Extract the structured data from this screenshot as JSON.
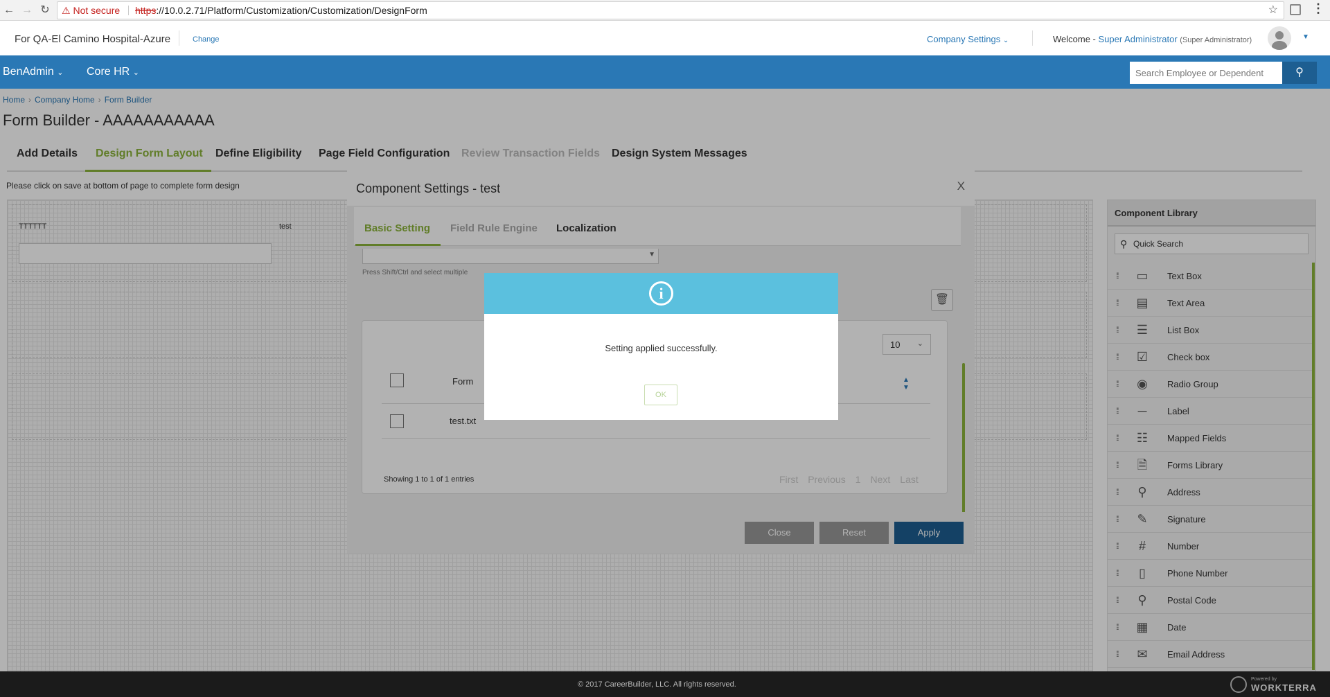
{
  "browser": {
    "security": "Not secure",
    "url_proto": "https",
    "url_rest": "://10.0.2.71/Platform/Customization/Customization/DesignForm"
  },
  "header": {
    "company": "For QA-El Camino Hospital-Azure",
    "change": "Change",
    "company_settings": "Company Settings",
    "welcome_prefix": "Welcome - ",
    "user_name": "Super Administrator",
    "user_role": "(Super Administrator)"
  },
  "nav": {
    "items": [
      "BenAdmin",
      "Core HR"
    ],
    "search_placeholder": "Search Employee or Dependent"
  },
  "breadcrumb": [
    "Home",
    "Company Home",
    "Form Builder"
  ],
  "page_title": "Form Builder - AAAAAAAAAAA",
  "tabs": [
    "Add Details",
    "Design Form Layout",
    "Define Eligibility",
    "Page Field Configuration",
    "Review Transaction Fields",
    "Design System Messages"
  ],
  "hint": "Please click on save at bottom of page to complete form design",
  "canvas": {
    "field1_label": "TTTTTT",
    "field2_label": "test"
  },
  "library": {
    "title": "Component Library",
    "search_placeholder": "Quick Search",
    "items": [
      {
        "label": "Text Box",
        "icon": "text-box-icon"
      },
      {
        "label": "Text Area",
        "icon": "text-area-icon"
      },
      {
        "label": "List Box",
        "icon": "list-box-icon"
      },
      {
        "label": "Check box",
        "icon": "checkbox-icon"
      },
      {
        "label": "Radio Group",
        "icon": "radio-group-icon"
      },
      {
        "label": "Label",
        "icon": "label-icon"
      },
      {
        "label": "Mapped Fields",
        "icon": "mapped-fields-icon"
      },
      {
        "label": "Forms Library",
        "icon": "forms-library-icon"
      },
      {
        "label": "Address",
        "icon": "map-pin-icon"
      },
      {
        "label": "Signature",
        "icon": "signature-icon"
      },
      {
        "label": "Number",
        "icon": "hash-icon"
      },
      {
        "label": "Phone Number",
        "icon": "phone-icon"
      },
      {
        "label": "Postal Code",
        "icon": "postal-pin-icon"
      },
      {
        "label": "Date",
        "icon": "calendar-icon"
      },
      {
        "label": "Email Address",
        "icon": "envelope-icon"
      }
    ]
  },
  "component_settings": {
    "title": "Component Settings - test",
    "tabs": [
      "Basic Setting",
      "Field Rule Engine",
      "Localization"
    ],
    "select_hint": "Press Shift/Ctrl and select multiple",
    "page_size": "10",
    "grid_header": "Form",
    "rows": [
      "test.txt"
    ],
    "showing": "Showing 1 to 1 of 1 entries",
    "pager": [
      "First",
      "Previous",
      "1",
      "Next",
      "Last"
    ],
    "buttons": {
      "close": "Close",
      "reset": "Reset",
      "apply": "Apply"
    }
  },
  "dialog": {
    "message": "Setting applied successfully.",
    "ok": "OK"
  },
  "footer": {
    "copyright": "© 2017 CareerBuilder, LLC. All rights reserved.",
    "powered_by": "Powered by",
    "brand": "WORKTERRA"
  }
}
